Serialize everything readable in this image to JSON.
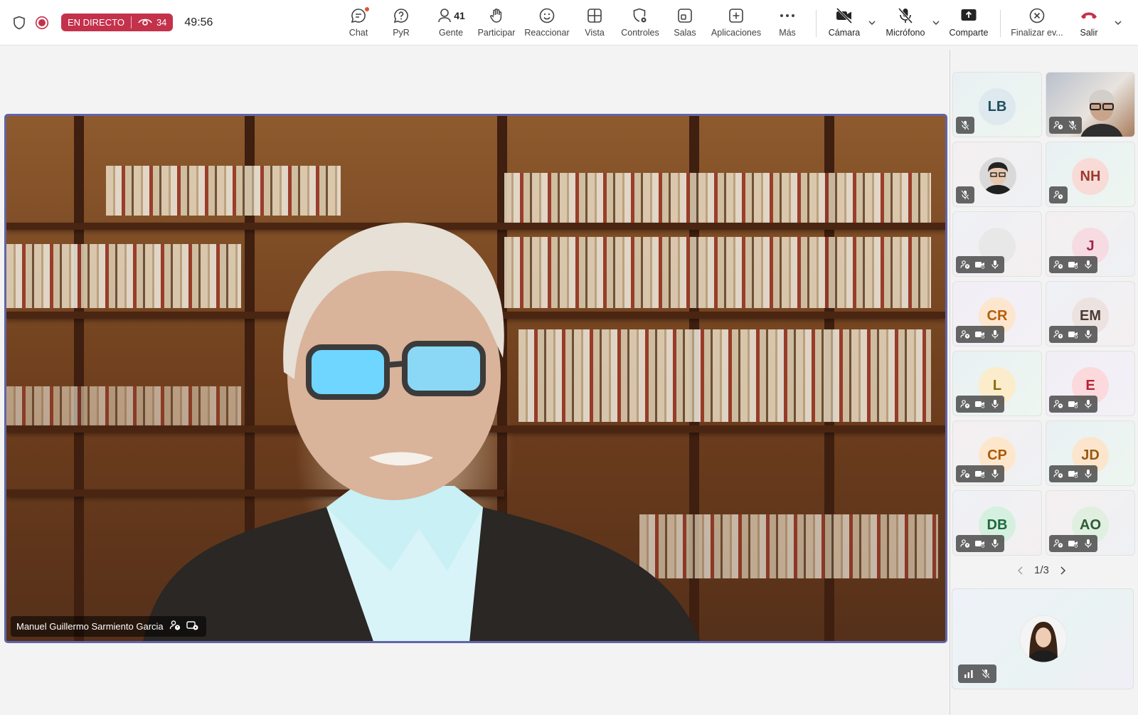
{
  "topbar": {
    "live_label": "EN DIRECTO",
    "viewer_count": "34",
    "timer": "49:56",
    "items": {
      "chat": "Chat",
      "qa": "PyR",
      "people": "Gente",
      "people_count": "41",
      "raise": "Participar",
      "react": "Reaccionar",
      "view": "Vista",
      "controls": "Controles",
      "rooms": "Salas",
      "apps": "Aplicaciones",
      "more": "Más",
      "camera": "Cámara",
      "mic": "Micrófono",
      "share": "Comparte",
      "end": "Finalizar ev...",
      "leave": "Salir"
    },
    "colors": {
      "live": "#c4314b",
      "leave": "#c4314b",
      "accent": "#6264a7"
    }
  },
  "stage": {
    "speaker_name": "Manuel Guillermo Sarmiento Garcia"
  },
  "participants": [
    {
      "initials": "LB",
      "type": "avatar",
      "bg": "#dde9ef",
      "fg": "#1f4e5f"
    },
    {
      "initials": "",
      "type": "video"
    },
    {
      "initials": "",
      "type": "photo"
    },
    {
      "initials": "NH",
      "type": "avatar",
      "bg": "#f8dbd6",
      "fg": "#9a3a2e"
    },
    {
      "initials": "",
      "type": "avatar",
      "bg": "#e8e8e8",
      "fg": "#555"
    },
    {
      "initials": "J",
      "type": "avatar",
      "bg": "#f7dbe3",
      "fg": "#a3264a"
    },
    {
      "initials": "CR",
      "type": "avatar",
      "bg": "#fde6cf",
      "fg": "#b45f0a"
    },
    {
      "initials": "EM",
      "type": "avatar",
      "bg": "#ece3e0",
      "fg": "#4b3b35"
    },
    {
      "initials": "L",
      "type": "avatar",
      "bg": "#fbeccb",
      "fg": "#8a6a06"
    },
    {
      "initials": "E",
      "type": "avatar",
      "bg": "#fbd9dc",
      "fg": "#b42335"
    },
    {
      "initials": "CP",
      "type": "avatar",
      "bg": "#fde7cc",
      "fg": "#ad5a08"
    },
    {
      "initials": "JD",
      "type": "avatar",
      "bg": "#fbe6cd",
      "fg": "#9a5a10"
    },
    {
      "initials": "DB",
      "type": "avatar",
      "bg": "#d6f0df",
      "fg": "#1d6b3d"
    },
    {
      "initials": "AO",
      "type": "avatar",
      "bg": "#e0efe0",
      "fg": "#2f5a35"
    }
  ],
  "pager": {
    "label": "1/3"
  }
}
